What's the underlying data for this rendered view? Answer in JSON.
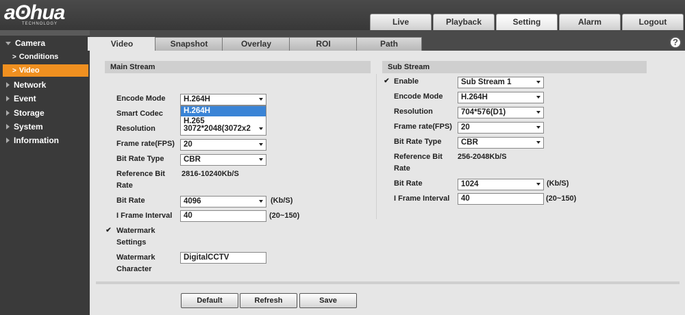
{
  "header": {
    "logo": "aʘhua",
    "logo_sub": "TECHNOLOGY",
    "tabs": [
      "Live",
      "Playback",
      "Setting",
      "Alarm",
      "Logout"
    ],
    "active_tab": "Setting"
  },
  "sidebar": {
    "camera": "Camera",
    "camera_items": [
      "Conditions",
      "Video"
    ],
    "active_item": "Video",
    "sections": [
      "Network",
      "Event",
      "Storage",
      "System",
      "Information"
    ]
  },
  "subtabs": [
    "Video",
    "Snapshot",
    "Overlay",
    "ROI",
    "Path"
  ],
  "help_icon": "?",
  "main_stream": {
    "title": "Main Stream",
    "encode_mode_label": "Encode Mode",
    "encode_mode": "H.264H",
    "encode_options": [
      "H.264H",
      "H.265"
    ],
    "smart_codec_label": "Smart Codec",
    "resolution_label": "Resolution",
    "resolution": "3072*2048(3072x2",
    "frame_rate_label": "Frame rate(FPS)",
    "frame_rate": "20",
    "bit_rate_type_label": "Bit Rate Type",
    "bit_rate_type": "CBR",
    "ref_bit_rate_label_1": "Reference Bit",
    "ref_bit_rate_label_2": "Rate",
    "ref_bit_rate": "2816-10240Kb/S",
    "bit_rate_label": "Bit Rate",
    "bit_rate": "4096",
    "bit_rate_unit": "(Kb/S)",
    "iframe_label": "I Frame Interval",
    "iframe": "40",
    "iframe_range": "(20~150)",
    "watermark_settings_1": "Watermark",
    "watermark_settings_2": "Settings",
    "watermark_char_1": "Watermark",
    "watermark_char_2": "Character",
    "watermark_char": "DigitalCCTV"
  },
  "sub_stream": {
    "title": "Sub Stream",
    "enable_label": "Enable",
    "enable_value": "Sub Stream 1",
    "encode_mode_label": "Encode Mode",
    "encode_mode": "H.264H",
    "resolution_label": "Resolution",
    "resolution": "704*576(D1)",
    "frame_rate_label": "Frame rate(FPS)",
    "frame_rate": "20",
    "bit_rate_type_label": "Bit Rate Type",
    "bit_rate_type": "CBR",
    "ref_bit_rate_label_1": "Reference Bit",
    "ref_bit_rate_label_2": "Rate",
    "ref_bit_rate": "256-2048Kb/S",
    "bit_rate_label": "Bit Rate",
    "bit_rate": "1024",
    "bit_rate_unit": "(Kb/S)",
    "iframe_label": "I Frame Interval",
    "iframe": "40",
    "iframe_range": "(20~150)"
  },
  "buttons": {
    "default": "Default",
    "refresh": "Refresh",
    "save": "Save"
  },
  "checkmark": "✔",
  "colors": {
    "accent": "#f09020",
    "header": "#3a3a3a",
    "dropdown_highlight": "#3a84d6"
  }
}
